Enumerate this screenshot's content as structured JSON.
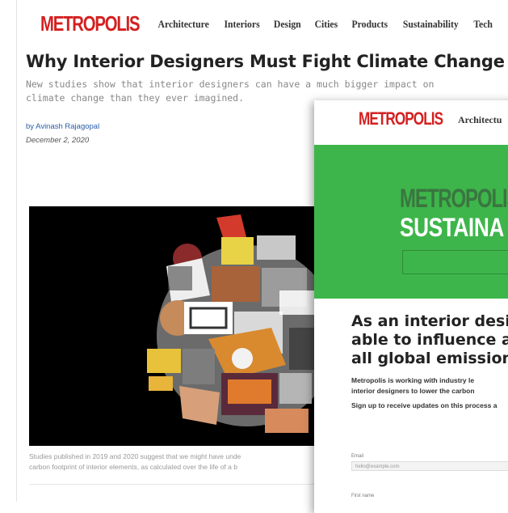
{
  "article": {
    "logo": "METROPOLIS",
    "nav": [
      "Architecture",
      "Interiors",
      "Design",
      "Cities",
      "Products",
      "Sustainability",
      "Tech"
    ],
    "title": "Why Interior Designers Must Fight Climate Change",
    "subtitle": "New studies show that interior designers can have a much bigger impact on climate change than they ever imagined.",
    "author": "by Avinash Rajagopal",
    "date": "December 2, 2020",
    "caption_line1": "Studies published in 2019 and 2020 suggest that we might have unde",
    "caption_line2": "carbon footprint of interior elements, as calculated over the life of a b"
  },
  "popup": {
    "logo": "METROPOLIS",
    "nav_item": "Architectu",
    "banner_logo": "METROPOLIS",
    "banner_title": "SUSTAINA",
    "heading_lines": [
      "As an interior desi",
      "able to influence a",
      "all global emission"
    ],
    "body_line1": "Metropolis is working with industry le",
    "body_line2": "interior designers to lower the carbon",
    "signup_text": "Sign up to receive updates on this process a",
    "email_label": "Email",
    "email_placeholder": "hello@example.com",
    "first_name_label": "First name"
  },
  "colors": {
    "brand_red": "#d42020",
    "banner_green": "#3db54a",
    "link_blue": "#2a5ea8"
  }
}
